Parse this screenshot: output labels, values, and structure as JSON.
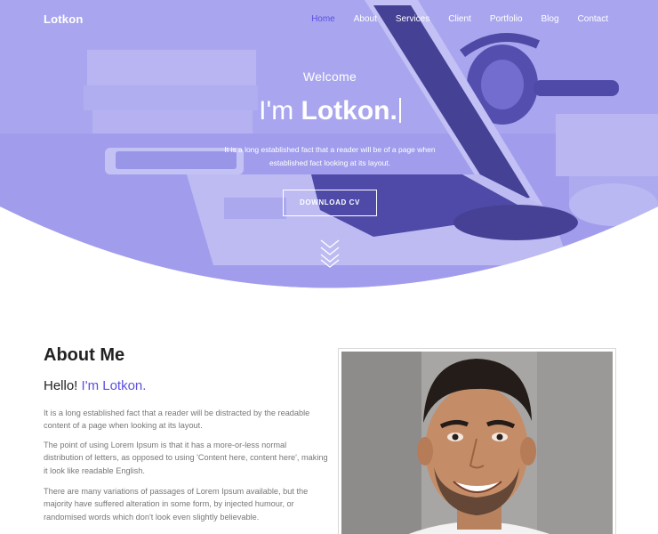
{
  "nav": {
    "brand": "Lotkon",
    "items": [
      {
        "label": "Home",
        "active": true
      },
      {
        "label": "About"
      },
      {
        "label": "Services"
      },
      {
        "label": "Client"
      },
      {
        "label": "Portfolio"
      },
      {
        "label": "Blog"
      },
      {
        "label": "Contact"
      }
    ]
  },
  "hero": {
    "welcome": "Welcome",
    "headline_prefix": "I'm ",
    "headline_name": "Lotkon.",
    "subtitle": "It is a long established fact that a reader will be of a page when established fact looking at its layout.",
    "cv_button": "DOWNLOAD CV",
    "overlay_color": "#8c86ea"
  },
  "about": {
    "title_bold": "About",
    "title_rest": " Me",
    "hello_prefix": "Hello! ",
    "hello_name": "I'm Lotkon.",
    "paragraphs": [
      "It is a long established fact that a reader will be distracted by the readable content of a page when looking at its layout.",
      "The point of using Lorem Ipsum is that it has a more-or-less normal distribution of letters, as opposed to using 'Content here, content here', making it look like readable English.",
      "There are many variations of passages of Lorem Ipsum available, but the majority have suffered alteration in some form, by injected humour, or randomised words which don't look even slightly believable."
    ],
    "accent_color": "#5b4fe0"
  }
}
